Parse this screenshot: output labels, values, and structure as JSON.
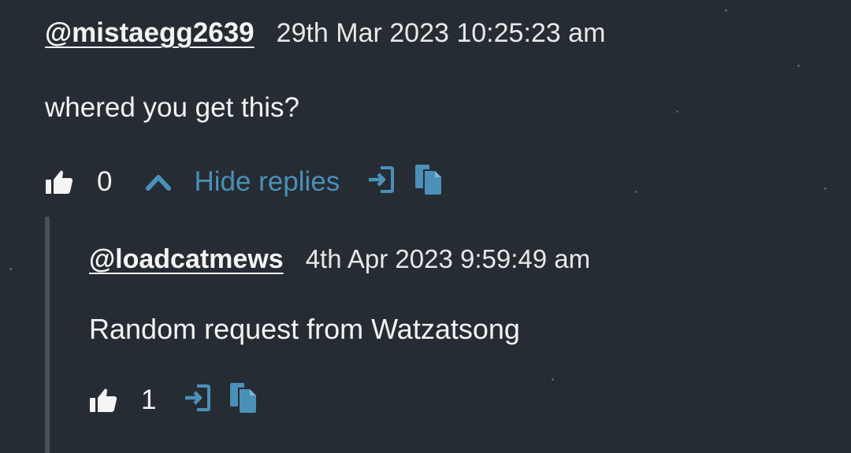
{
  "comment": {
    "author": "@mistaegg2639",
    "timestamp": "29th Mar 2023 10:25:23 am",
    "text": "whered you get this?",
    "likes": "0",
    "toggle_label": "Hide replies",
    "like_icon": "thumbs-up-icon",
    "toggle_icon": "chevron-up-icon",
    "share_icon": "sign-in-icon",
    "copy_icon": "copy-icon"
  },
  "reply": {
    "author": "@loadcatmews",
    "timestamp": "4th Apr 2023 9:59:49 am",
    "text": "Random request from Watzatsong",
    "likes": "1",
    "like_icon": "thumbs-up-icon",
    "share_icon": "sign-in-icon",
    "copy_icon": "copy-icon"
  },
  "colors": {
    "background": "#262c33",
    "accent": "#4a90b8",
    "text": "#f2f2f2",
    "thread_line": "#4a5058"
  }
}
